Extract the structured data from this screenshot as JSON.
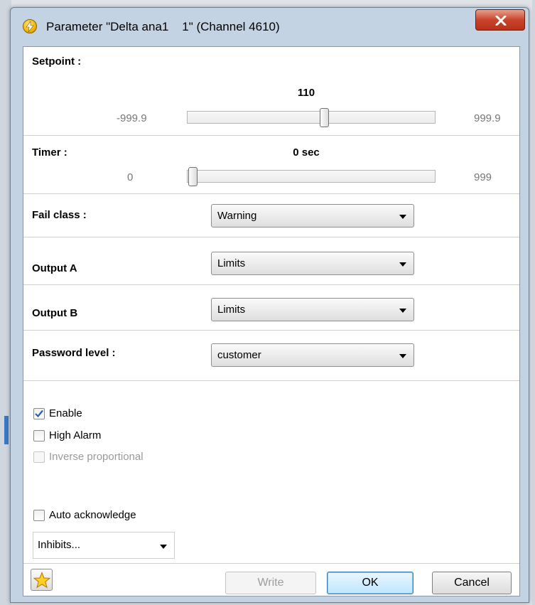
{
  "window": {
    "title": "Parameter \"Delta ana1    1\" (Channel 4610)"
  },
  "setpoint": {
    "label": "Setpoint :",
    "value": "110",
    "min": "-999.9",
    "max": "999.9",
    "slider_fraction": 0.555
  },
  "timer": {
    "label": "Timer :",
    "value": "0 sec",
    "min": "0",
    "max": "999",
    "slider_fraction": 0.0
  },
  "fail_class": {
    "label": "Fail class :",
    "selected": "Warning"
  },
  "output_a": {
    "label": "Output A",
    "selected": "Limits"
  },
  "output_b": {
    "label": "Output B",
    "selected": "Limits"
  },
  "password_level": {
    "label": "Password level :",
    "selected": "customer"
  },
  "checkboxes": {
    "enable": {
      "label": "Enable",
      "checked": true
    },
    "high_alarm": {
      "label": "High Alarm",
      "checked": false
    },
    "inverse_proportional": {
      "label": "Inverse proportional",
      "checked": false,
      "disabled": true
    },
    "auto_acknowledge": {
      "label": "Auto acknowledge",
      "checked": false
    }
  },
  "inhibits": {
    "selected": "Inhibits..."
  },
  "buttons": {
    "write": "Write",
    "ok": "OK",
    "cancel": "Cancel"
  },
  "colors": {
    "close_button": "#c9442a",
    "default_button": "#bee6fd",
    "check_mark": "#2a5fb0"
  }
}
